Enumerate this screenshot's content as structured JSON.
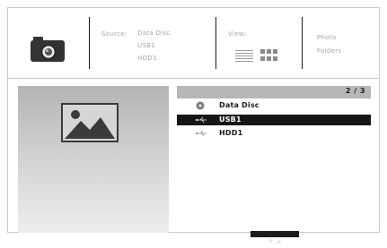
{
  "header": {
    "source_label": "Source:",
    "sources": [
      "Data Disc",
      "USB1",
      "HDD1"
    ],
    "view_label": "View:",
    "media_types": [
      "Photo",
      "Folders"
    ]
  },
  "list": {
    "page_indicator": "2 / 3",
    "items": [
      {
        "label": "Data Disc",
        "icon": "disc-icon",
        "selected": false
      },
      {
        "label": "USB1",
        "icon": "usb-icon",
        "selected": true
      },
      {
        "label": "HDD1",
        "icon": "usb-icon",
        "selected": false
      }
    ]
  },
  "colors": {
    "selection": "#161616",
    "list_header": "#b7b7b7",
    "preview_top": "#b4b4b4",
    "preview_bottom": "#eeeeee"
  }
}
